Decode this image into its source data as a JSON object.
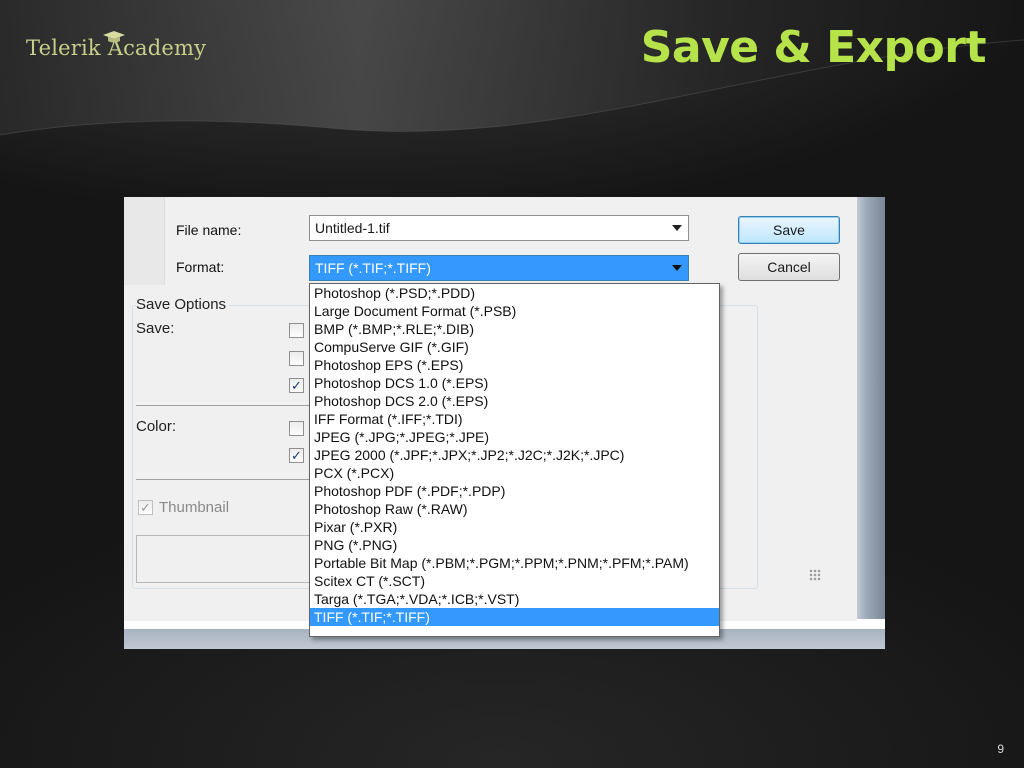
{
  "slide": {
    "logo_text": "Telerik Academy",
    "title": "Save & Export",
    "page_number": "9",
    "title_color": "#b6e34a"
  },
  "dialog": {
    "file_name_label": "File name:",
    "file_name_value": "Untitled-1.tif",
    "format_label": "Format:",
    "format_value": "TIFF (*.TIF;*.TIFF)",
    "save_button": "Save",
    "cancel_button": "Cancel",
    "save_options_label": "Save Options",
    "save_label": "Save:",
    "color_label": "Color:",
    "thumbnail_label": "Thumbnail",
    "checkboxes": {
      "save_1": false,
      "save_2": false,
      "save_3": true,
      "color_1": false,
      "color_2": true,
      "thumbnail": true
    },
    "accent_color": "#3399ff"
  },
  "format_dropdown": {
    "items": [
      "Photoshop (*.PSD;*.PDD)",
      "Large Document Format (*.PSB)",
      "BMP (*.BMP;*.RLE;*.DIB)",
      "CompuServe GIF (*.GIF)",
      "Photoshop EPS (*.EPS)",
      "Photoshop DCS 1.0 (*.EPS)",
      "Photoshop DCS 2.0 (*.EPS)",
      "IFF Format (*.IFF;*.TDI)",
      "JPEG (*.JPG;*.JPEG;*.JPE)",
      "JPEG 2000 (*.JPF;*.JPX;*.JP2;*.J2C;*.J2K;*.JPC)",
      "PCX (*.PCX)",
      "Photoshop PDF (*.PDF;*.PDP)",
      "Photoshop Raw (*.RAW)",
      "Pixar (*.PXR)",
      "PNG (*.PNG)",
      "Portable Bit Map (*.PBM;*.PGM;*.PPM;*.PNM;*.PFM;*.PAM)",
      "Scitex CT (*.SCT)",
      "Targa (*.TGA;*.VDA;*.ICB;*.VST)",
      "TIFF (*.TIF;*.TIFF)"
    ],
    "selected_index": 18
  }
}
